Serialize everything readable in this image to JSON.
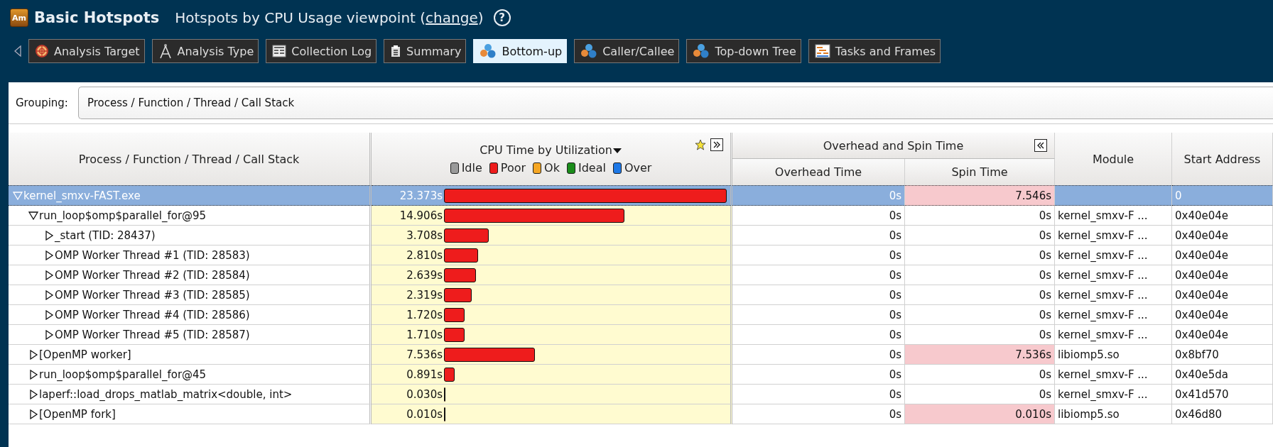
{
  "window": {
    "logo": "Am",
    "title": "Basic Hotspots",
    "subtitle": "Hotspots by CPU Usage viewpoint (",
    "link": "change",
    "subtitle_end": ")",
    "help": "?"
  },
  "tabs": [
    {
      "label": "Analysis Target",
      "kind": "target",
      "selected": false
    },
    {
      "label": "Analysis Type",
      "kind": "compass",
      "selected": false
    },
    {
      "label": "Collection Log",
      "kind": "log",
      "selected": false
    },
    {
      "label": "Summary",
      "kind": "summary",
      "selected": false
    },
    {
      "label": "Bottom-up",
      "kind": "balls",
      "selected": true
    },
    {
      "label": "Caller/Callee",
      "kind": "balls",
      "selected": false
    },
    {
      "label": "Top-down Tree",
      "kind": "balls",
      "selected": false
    },
    {
      "label": "Tasks and Frames",
      "kind": "frames",
      "selected": false
    }
  ],
  "grouping": {
    "label": "Grouping:",
    "value": "Process / Function / Thread / Call Stack"
  },
  "table": {
    "columns": {
      "name": "Process / Function / Thread / Call Stack",
      "cpu": "CPU Time by Utilization",
      "group": "Overhead and Spin Time",
      "overhead": "Overhead Time",
      "spin": "Spin Time",
      "module": "Module",
      "address": "Start Address"
    },
    "legend": [
      {
        "label": "Idle",
        "color": "#9a9a9a"
      },
      {
        "label": "Poor",
        "color": "#ee1c1c"
      },
      {
        "label": "Ok",
        "color": "#f5a623"
      },
      {
        "label": "Ideal",
        "color": "#1a8c1a"
      },
      {
        "label": "Over",
        "color": "#1e78e6"
      }
    ],
    "rows": [
      {
        "name": "kernel_smxv-FAST.exe",
        "expanded": true,
        "selected": true,
        "cpu": "23.373s",
        "overhead": "0s",
        "spin": "7.546s",
        "spin_high": true,
        "address": "0",
        "children": [
          {
            "name": "run_loop$omp$parallel_for@95",
            "expanded": true,
            "selected": false,
            "cpu": "14.906s",
            "overhead": "0s",
            "spin": "0s",
            "spin_high": false,
            "module": "kernel_smxv-F ...",
            "address": "0x40e04e",
            "children": [
              {
                "name": "_start (TID: 28437)",
                "expanded": false,
                "selected": false,
                "cpu": "3.708s",
                "overhead": "0s",
                "spin": "0s",
                "spin_high": false,
                "module": "kernel_smxv-F ...",
                "address": "0x40e04e"
              },
              {
                "name": "OMP Worker Thread #1 (TID: 28583)",
                "expanded": false,
                "selected": false,
                "cpu": "2.810s",
                "overhead": "0s",
                "spin": "0s",
                "spin_high": false,
                "module": "kernel_smxv-F ...",
                "address": "0x40e04e"
              },
              {
                "name": "OMP Worker Thread #2 (TID: 28584)",
                "expanded": false,
                "selected": false,
                "cpu": "2.639s",
                "overhead": "0s",
                "spin": "0s",
                "spin_high": false,
                "module": "kernel_smxv-F ...",
                "address": "0x40e04e"
              },
              {
                "name": "OMP Worker Thread #3 (TID: 28585)",
                "expanded": false,
                "selected": false,
                "cpu": "2.319s",
                "overhead": "0s",
                "spin": "0s",
                "spin_high": false,
                "module": "kernel_smxv-F ...",
                "address": "0x40e04e"
              },
              {
                "name": "OMP Worker Thread #4 (TID: 28586)",
                "expanded": false,
                "selected": false,
                "cpu": "1.720s",
                "overhead": "0s",
                "spin": "0s",
                "spin_high": false,
                "module": "kernel_smxv-F ...",
                "address": "0x40e04e"
              },
              {
                "name": "OMP Worker Thread #5 (TID: 28587)",
                "expanded": false,
                "selected": false,
                "cpu": "1.710s",
                "overhead": "0s",
                "spin": "0s",
                "spin_high": false,
                "module": "kernel_smxv-F ...",
                "address": "0x40e04e"
              }
            ]
          },
          {
            "name": "[OpenMP worker]",
            "expanded": false,
            "selected": false,
            "cpu": "7.536s",
            "overhead": "0s",
            "spin": "7.536s",
            "spin_high": true,
            "module": "libiomp5.so",
            "address": "0x8bf70"
          },
          {
            "name": "run_loop$omp$parallel_for@45",
            "expanded": false,
            "selected": false,
            "cpu": "0.891s",
            "overhead": "0s",
            "spin": "0s",
            "spin_high": false,
            "module": "kernel_smxv-F ...",
            "address": "0x40e5da"
          },
          {
            "name": "laperf::load_drops_matlab_matrix<double, int>",
            "expanded": false,
            "selected": false,
            "cpu": "0.030s",
            "overhead": "0s",
            "spin": "0s",
            "spin_high": false,
            "module": "kernel_smxv-F ...",
            "address": "0x41d570"
          },
          {
            "name": "[OpenMP fork]",
            "expanded": false,
            "selected": false,
            "cpu": "0.010s",
            "overhead": "0s",
            "spin": "0.010s",
            "spin_high": true,
            "module": "libiomp5.so",
            "address": "0x46d80"
          }
        ]
      }
    ]
  }
}
